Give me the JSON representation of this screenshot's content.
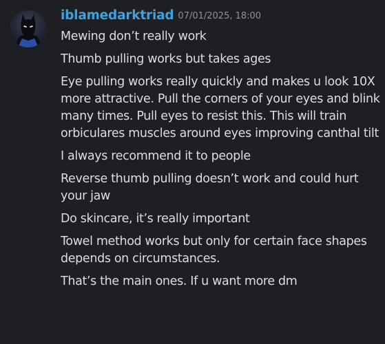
{
  "author": {
    "username": "iblamedarktriad",
    "timestamp": "07/01/2025, 18:00",
    "avatar_icon": "batman-avatar-icon"
  },
  "messages": [
    "Mewing don’t really work",
    "Thumb pulling works but takes ages",
    "Eye pulling works really quickly and makes u look 10X more attractive. Pull the corners of your eyes and blink many times. Pull eyes to resist this. This will train orbiculares muscles around eyes improving canthal tilt",
    "I always recommend it to people",
    "Reverse thumb pulling doesn’t work and could hurt your jaw",
    "Do skincare, it’s really important",
    "Towel method works but only for certain face shapes depends on circumstances.",
    "That’s the main ones. If u want more dm"
  ],
  "colors": {
    "background": "#1e1f22",
    "username": "#3fa2e0",
    "timestamp": "#8e9297",
    "message_text": "#dbdee1"
  }
}
